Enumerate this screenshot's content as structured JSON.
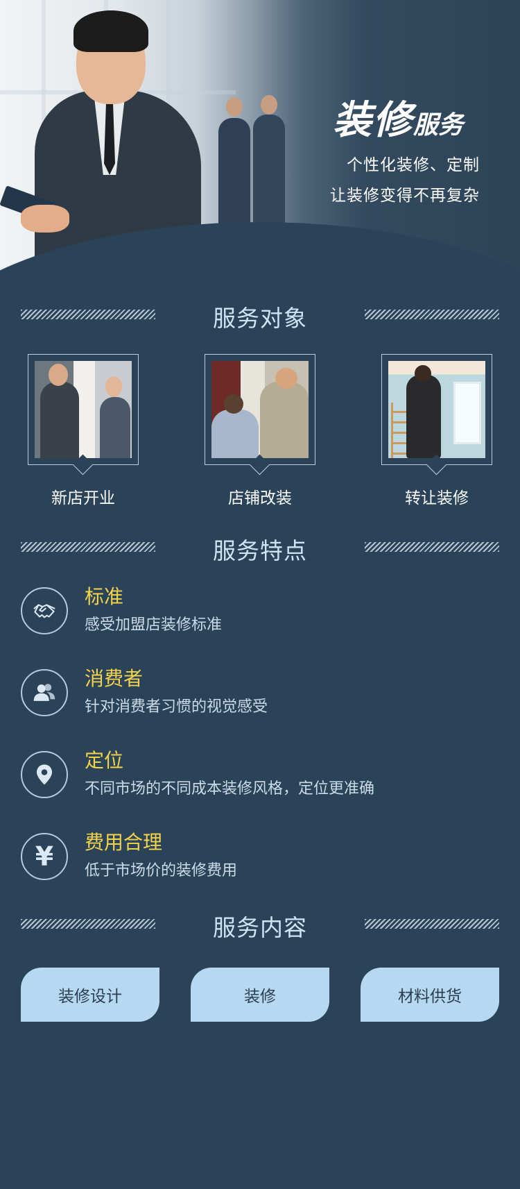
{
  "hero": {
    "title_big": "装修",
    "title_small": "服务",
    "subtitle_line1": "个性化装修、定制",
    "subtitle_line2": "让装修变得不再复杂"
  },
  "sections": {
    "targets_title": "服务对象",
    "features_title": "服务特点",
    "content_title": "服务内容"
  },
  "targets": [
    {
      "label": "新店开业"
    },
    {
      "label": "店铺改装"
    },
    {
      "label": "转让装修"
    }
  ],
  "features": [
    {
      "icon": "handshake-icon",
      "title": "标准",
      "desc": "感受加盟店装修标准"
    },
    {
      "icon": "users-icon",
      "title": "消费者",
      "desc": "针对消费者习惯的视觉感受"
    },
    {
      "icon": "location-pin-icon",
      "title": "定位",
      "desc": "不同市场的不同成本装修风格，定位更准确"
    },
    {
      "icon": "yen-icon",
      "title": "费用合理",
      "desc": "低于市场价的装修费用",
      "symbol": "¥"
    }
  ],
  "services": [
    {
      "label": "装修设计"
    },
    {
      "label": "装修"
    },
    {
      "label": "材料供货"
    }
  ],
  "colors": {
    "background": "#2b4359",
    "accent_yellow": "#f3d34a",
    "section_title": "#cfe3f5",
    "chip": "#b7d8f1"
  }
}
